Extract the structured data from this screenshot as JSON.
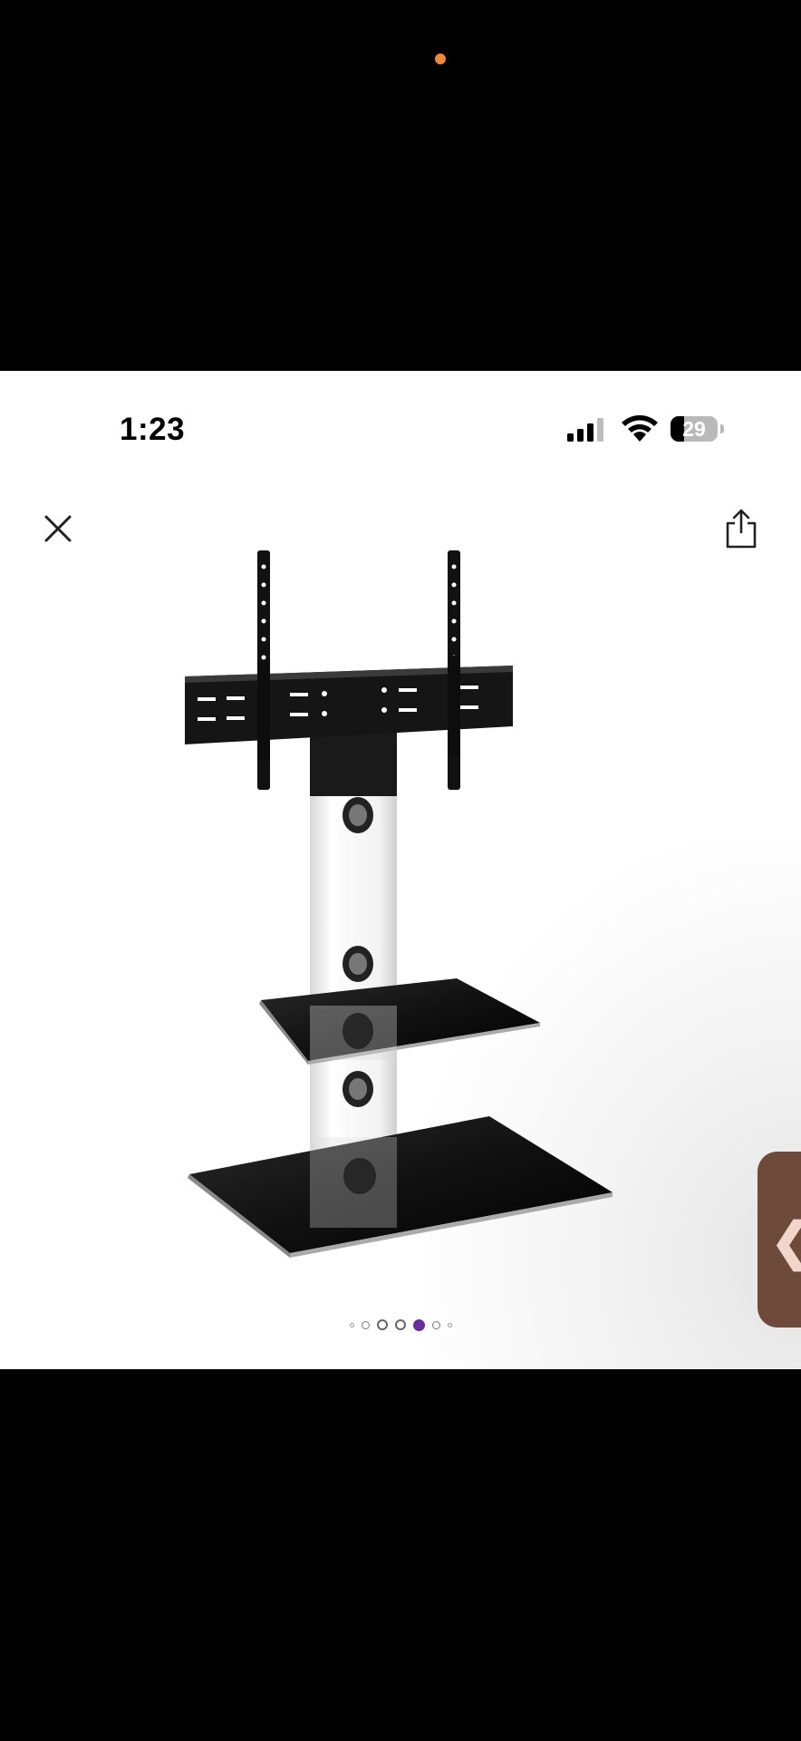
{
  "status_bar": {
    "time": "1:23",
    "battery_percent": "29",
    "battery_level": 0.29
  },
  "toolbar": {
    "close_icon": "close-icon",
    "share_icon": "share-icon"
  },
  "gallery": {
    "image_subject": "tv-stand-product-image",
    "page_count": 7,
    "current_page": 5,
    "active_dot_color": "#6a2ca0"
  },
  "side_handle": {
    "icon": "chevron-left-icon",
    "glyph": "❮",
    "color": "#6e4a3a"
  },
  "camera_indicator_color": "#f0883a"
}
